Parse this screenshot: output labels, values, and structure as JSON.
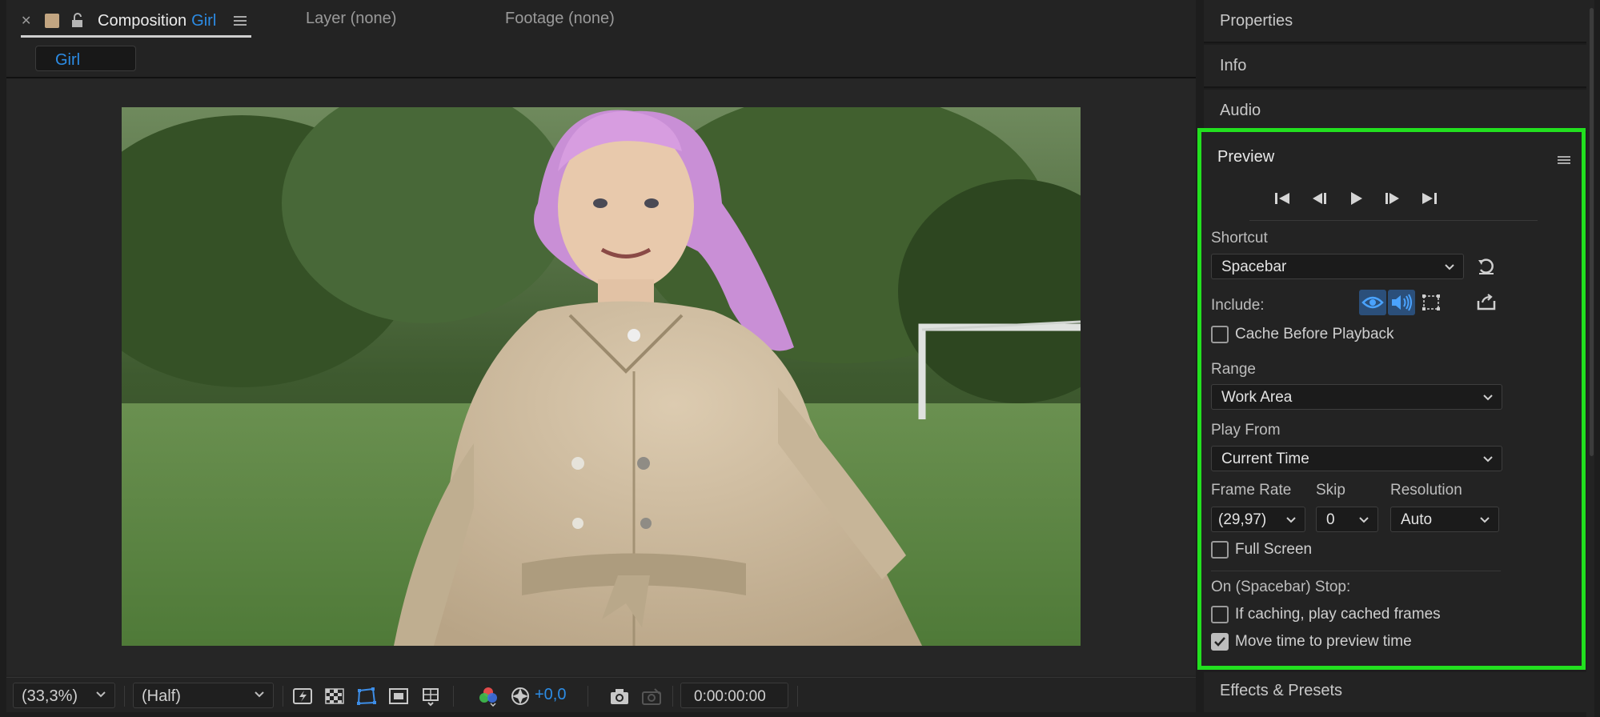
{
  "comp_panel": {
    "tabs": {
      "composition_prefix": "Composition",
      "composition_name": "Girl",
      "layer": "Layer (none)",
      "footage": "Footage (none)"
    },
    "subtab": "Girl",
    "bottom_bar": {
      "zoom": "(33,3%)",
      "resolution": "(Half)",
      "exposure": "+0,0",
      "timecode": "0:00:00:00"
    }
  },
  "right_panel": {
    "collapsed_top": [
      "Properties",
      "Info",
      "Audio"
    ],
    "collapsed_bottom": "Effects & Presets",
    "preview": {
      "title": "Preview",
      "shortcut_label": "Shortcut",
      "shortcut_value": "Spacebar",
      "include_label": "Include:",
      "cache_before_playback": "Cache Before Playback",
      "range_label": "Range",
      "range_value": "Work Area",
      "play_from_label": "Play From",
      "play_from_value": "Current Time",
      "frame_rate_label": "Frame Rate",
      "frame_rate_value": "(29,97)",
      "skip_label": "Skip",
      "skip_value": "0",
      "resolution_label": "Resolution",
      "resolution_value": "Auto",
      "full_screen": "Full Screen",
      "on_stop_label": "On (Spacebar) Stop:",
      "if_caching": "If caching, play cached frames",
      "move_time": "Move time to preview time",
      "checks": {
        "cache_before_playback": false,
        "full_screen": false,
        "if_caching": false,
        "move_time": true
      }
    }
  },
  "colors": {
    "accent_blue": "#2c8ce5",
    "highlight_green": "#22e01f",
    "panel_bg": "#232323"
  }
}
